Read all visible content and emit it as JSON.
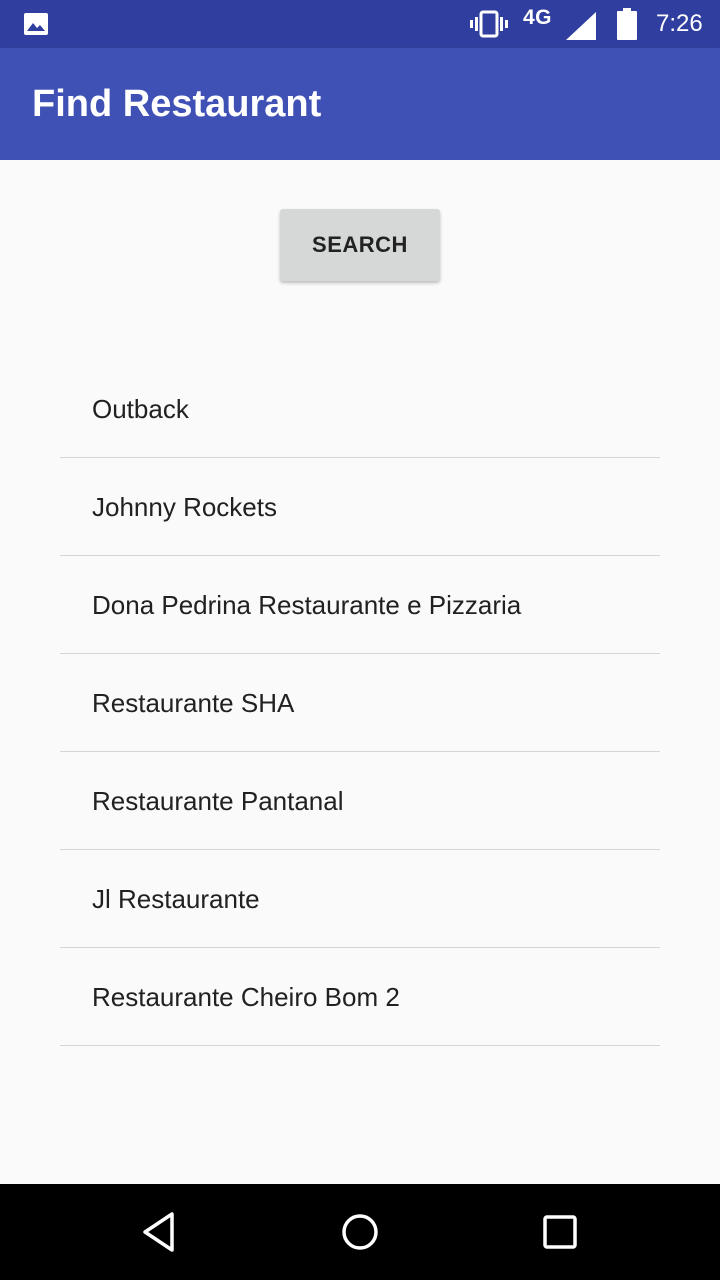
{
  "status_bar": {
    "network_type": "4G",
    "time": "7:26",
    "icons": [
      "image-notification-icon",
      "vibrate-icon",
      "signal-icon",
      "battery-icon"
    ]
  },
  "app_bar": {
    "title": "Find Restaurant"
  },
  "search_button": {
    "label": "SEARCH"
  },
  "restaurants": [
    "Outback",
    "Johnny Rockets",
    "Dona Pedrina Restaurante e Pizzaria",
    "Restaurante SHA",
    "Restaurante Pantanal",
    "Jl Restaurante",
    "Restaurante Cheiro Bom 2"
  ],
  "nav_bar": {
    "icons": [
      "back-icon",
      "home-icon",
      "recents-icon"
    ]
  },
  "colors": {
    "status_bar": "#303f9f",
    "app_bar": "#3f51b5",
    "background": "#fafafa",
    "button": "#d6d7d7"
  }
}
